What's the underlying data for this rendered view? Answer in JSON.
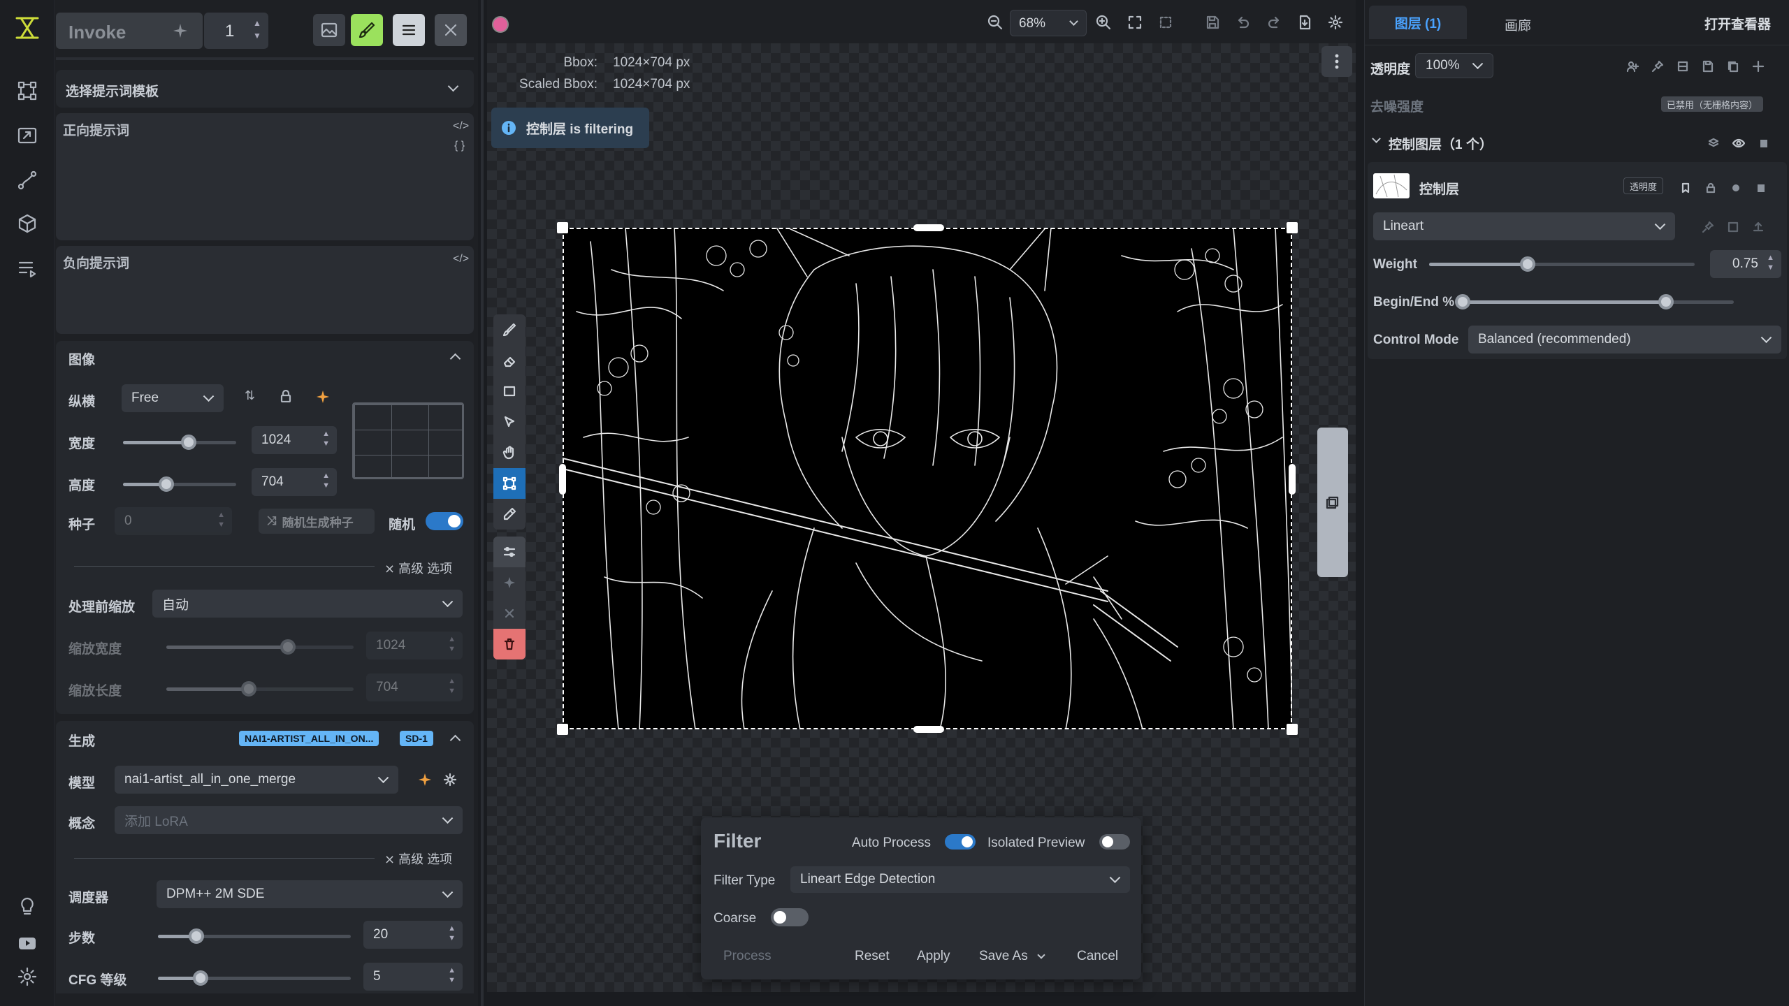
{
  "app": {
    "invoke_label": "Invoke",
    "batch_count": "1"
  },
  "left": {
    "prompt_template": "选择提示词模板",
    "positive_label": "正向提示词",
    "negative_label": "负向提示词",
    "image_section": "图像",
    "aspect_label": "纵横",
    "aspect_value": "Free",
    "width_label": "宽度",
    "width_value": "1024",
    "width_fraction": 0.58,
    "height_label": "高度",
    "height_value": "704",
    "height_fraction": 0.38,
    "seed_label": "种子",
    "seed_value": "0",
    "random_seed_button": "随机生成种子",
    "random_label": "随机",
    "advanced_label": "高级 选项",
    "scale_before_label": "处理前缩放",
    "scale_before_value": "自动",
    "scaled_width_label": "缩放宽度",
    "scaled_width_value": "1024",
    "scaled_width_fraction": 0.65,
    "scaled_height_label": "缩放长度",
    "scaled_height_value": "704",
    "scaled_height_fraction": 0.44,
    "generation_section": "生成",
    "model_badge": "NAI1-ARTIST_ALL_IN_ON...",
    "base_badge": "SD-1",
    "model_label": "模型",
    "model_value": "nai1-artist_all_in_one_merge",
    "concept_label": "概念",
    "concept_placeholder": "添加 LoRA",
    "advanced_label2": "高级 选项",
    "scheduler_label": "调度器",
    "scheduler_value": "DPM++ 2M SDE",
    "steps_label": "步数",
    "steps_value": "20",
    "steps_fraction": 0.2,
    "cfg_label": "CFG 等级",
    "cfg_value": "5",
    "cfg_fraction": 0.22
  },
  "canvas": {
    "zoom": "68%",
    "bbox_label": "Bbox:",
    "bbox_value": "1024×704 px",
    "scaled_bbox_label": "Scaled Bbox:",
    "scaled_bbox_value": "1024×704 px",
    "status_toast": "控制层 is filtering"
  },
  "filter": {
    "title": "Filter",
    "auto_process_label": "Auto Process",
    "auto_process_on": true,
    "isolated_preview_label": "Isolated Preview",
    "isolated_preview_on": false,
    "filter_type_label": "Filter Type",
    "filter_type_value": "Lineart Edge Detection",
    "coarse_label": "Coarse",
    "coarse_on": false,
    "process_button": "Process",
    "reset_button": "Reset",
    "apply_button": "Apply",
    "save_as_button": "Save As",
    "cancel_button": "Cancel"
  },
  "right": {
    "tab_layers": "图层 (1)",
    "tab_gallery": "画廊",
    "open_viewer": "打开查看器",
    "opacity_label": "透明度",
    "opacity_value": "100%",
    "denoise_label": "去噪强度",
    "denoise_badge": "已禁用（无栅格内容）",
    "control_layers_header": "控制图层（1 个）",
    "layer_name": "控制层",
    "layer_opacity_tag": "透明度",
    "model_value": "Lineart",
    "weight_label": "Weight",
    "weight_value": "0.75",
    "weight_fraction": 0.37,
    "begin_end_label": "Begin/End %",
    "begin_value": 0,
    "end_value": 0.75,
    "control_mode_label": "Control Mode",
    "control_mode_value": "Balanced (recommended)"
  },
  "colors": {
    "accent_blue": "#2b79c9",
    "brush_green": "#9be15d",
    "delete_red": "#e57373",
    "color_swatch": "#e0609a"
  }
}
